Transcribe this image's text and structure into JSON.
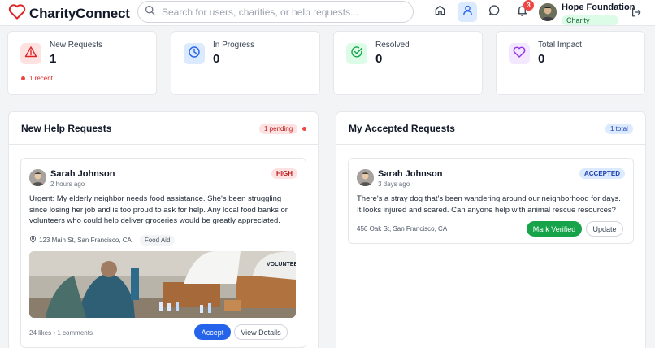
{
  "app": {
    "name": "CharityConnect"
  },
  "search": {
    "placeholder": "Search for users, charities, or help requests..."
  },
  "nav": {
    "notifications_count": "3"
  },
  "profile": {
    "name": "Hope Foundation",
    "role": "Charity"
  },
  "stats": [
    {
      "label": "New Requests",
      "value": "1",
      "sub": "1 recent",
      "icon": "alert-triangle-icon",
      "color": "#fee2e2"
    },
    {
      "label": "In Progress",
      "value": "0",
      "icon": "clock-icon",
      "color": "#dbeafe"
    },
    {
      "label": "Resolved",
      "value": "0",
      "icon": "check-circle-icon",
      "color": "#dcfce7"
    },
    {
      "label": "Total Impact",
      "value": "0",
      "icon": "heart-icon",
      "color": "#f3e8ff"
    }
  ],
  "new_requests": {
    "title": "New Help Requests",
    "badge": "1 pending",
    "card": {
      "name": "Sarah Johnson",
      "time": "2 hours ago",
      "priority": "HIGH",
      "description": "Urgent: My elderly neighbor needs food assistance. She's been struggling since losing her job and is too proud to ask for help. Any local food banks or volunteers who could help deliver groceries would be greatly appreciated.",
      "location": "123 Main St, San Francisco, CA",
      "tag": "Food Aid",
      "image_text": "VOLUNTEER",
      "meta": "24 likes • 1 comments",
      "accept_label": "Accept",
      "details_label": "View Details"
    }
  },
  "accepted_requests": {
    "title": "My Accepted Requests",
    "badge": "1 total",
    "card": {
      "name": "Sarah Johnson",
      "time": "3 days ago",
      "status": "ACCEPTED",
      "description": "There's a stray dog that's been wandering around our neighborhood for days. It looks injured and scared. Can anyone help with animal rescue resources?",
      "location": "456 Oak St, San Francisco, CA",
      "verify_label": "Mark Verified",
      "update_label": "Update"
    }
  }
}
